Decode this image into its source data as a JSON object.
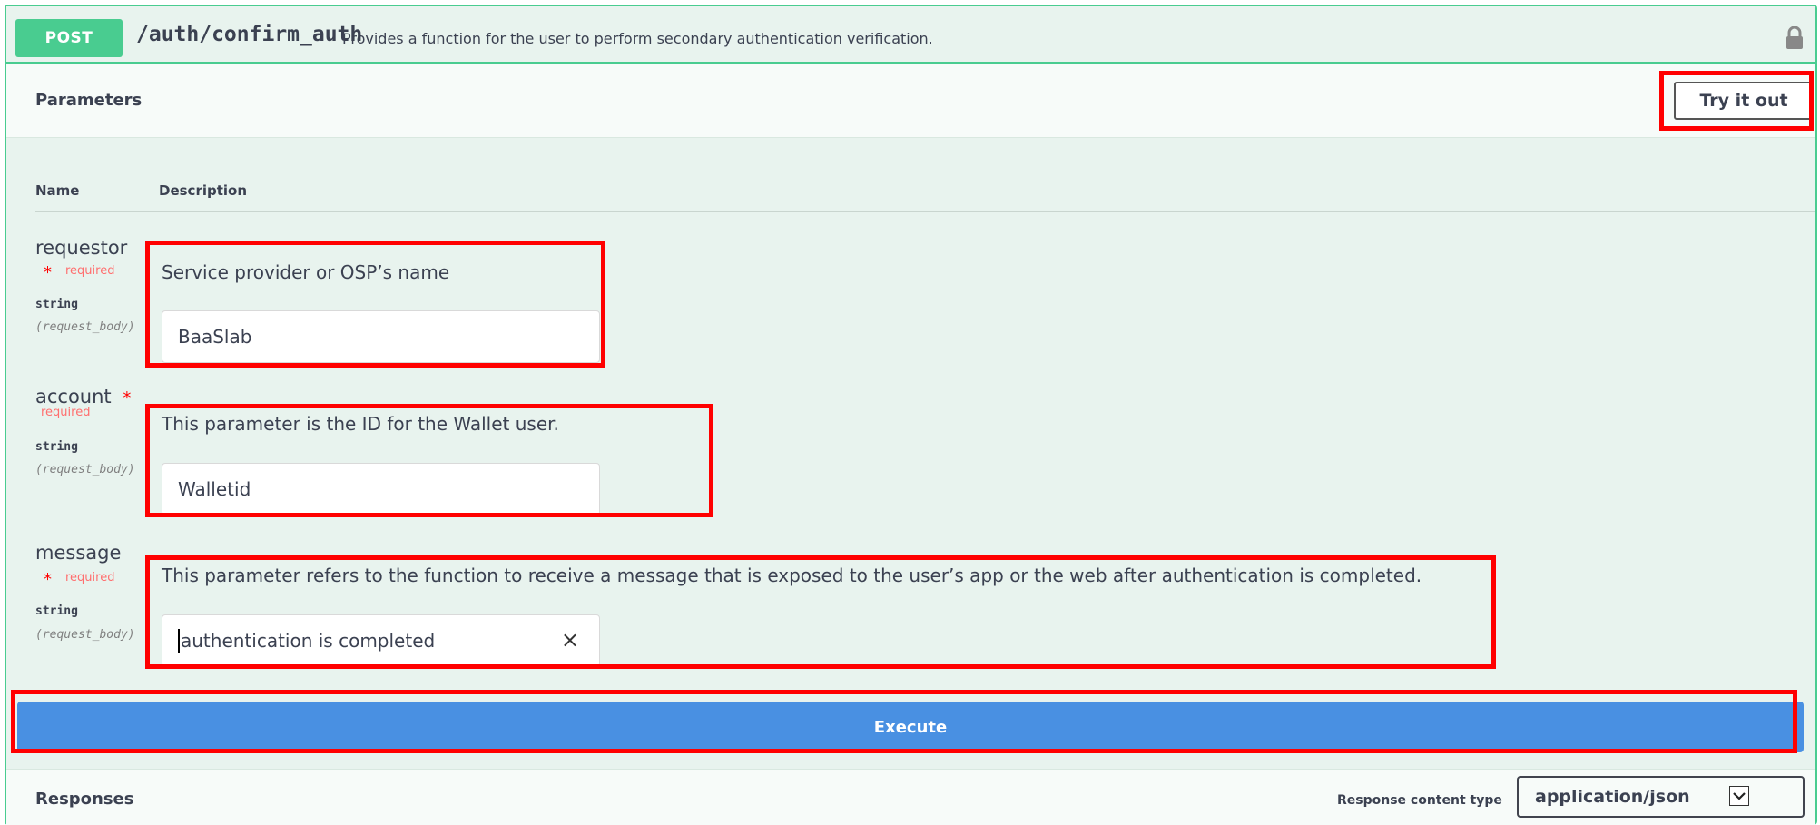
{
  "endpoint": {
    "method": "POST",
    "path": "/auth/confirm_auth",
    "description": "Provides a function for the user to perform secondary authentication verification.",
    "lock_icon": "lock-icon"
  },
  "parameters_section": {
    "title": "Parameters",
    "try_it_out": "Try it out",
    "columns": {
      "name": "Name",
      "description": "Description"
    }
  },
  "params": [
    {
      "name": "requestor",
      "required_star": "*",
      "required_label": "required",
      "type": "string",
      "in": "(request_body)",
      "description": "Service provider or OSP’s name",
      "value": "BaaSlab"
    },
    {
      "name": "account",
      "required_star": "*",
      "required_label": "required",
      "type": "string",
      "in": "(request_body)",
      "description": "This parameter is the ID for the Wallet user.",
      "value": "Walletid"
    },
    {
      "name": "message",
      "required_star": "*",
      "required_label": "required",
      "type": "string",
      "in": "(request_body)",
      "description": "This parameter refers to the function to receive a message that is exposed to the user’s app or the web after authentication is completed.",
      "value": "authentication is completed",
      "clear_icon": "×"
    }
  ],
  "execute_label": "Execute",
  "responses": {
    "title": "Responses",
    "content_type_label": "Response content type",
    "content_type_value": "application/json"
  },
  "colors": {
    "post": "#49cc90",
    "execute": "#4990e2",
    "highlight": "#ff0000",
    "required": "#ff6f6f"
  }
}
